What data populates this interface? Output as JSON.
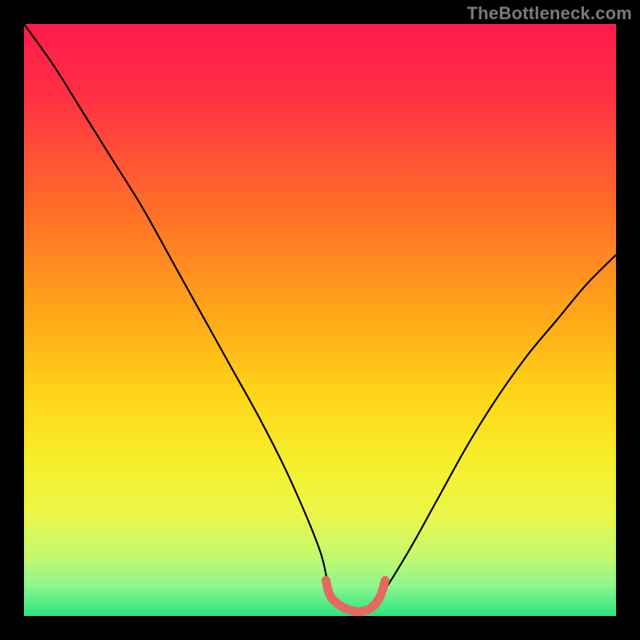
{
  "watermark": "TheBottleneck.com",
  "chart_data": {
    "type": "line",
    "title": "",
    "xlabel": "",
    "ylabel": "",
    "xlim": [
      0,
      100
    ],
    "ylim": [
      0,
      100
    ],
    "description": "Bottleneck curve. Y-axis is bottleneck percentage (100 at top, 0 at bottom). X-axis is component balance ratio (0–100). The curve descends from top-left, reaches a flat minimum near 0% around x≈52–60, then rises again toward the right. A short salmon segment marks the optimal flat region. Background is a vertical rainbow gradient (red→yellow→green) representing severity.",
    "series": [
      {
        "name": "bottleneck-curve",
        "x": [
          0,
          5,
          10,
          15,
          20,
          25,
          30,
          35,
          40,
          45,
          50,
          52,
          55,
          58,
          60,
          65,
          70,
          75,
          80,
          85,
          90,
          95,
          100
        ],
        "y": [
          100,
          93,
          85,
          77,
          69,
          60,
          51,
          42,
          33,
          23,
          11,
          3,
          1,
          1,
          3,
          11,
          20,
          29,
          37,
          44,
          50,
          56,
          61
        ]
      },
      {
        "name": "optimal-marker",
        "x": [
          51,
          52,
          55,
          58,
          60,
          61
        ],
        "y": [
          6,
          3,
          1,
          1,
          3,
          6
        ]
      }
    ],
    "gradient_stops": [
      {
        "offset": 0.0,
        "color": "#ff1a4b"
      },
      {
        "offset": 0.12,
        "color": "#ff3044"
      },
      {
        "offset": 0.3,
        "color": "#ff6a2a"
      },
      {
        "offset": 0.48,
        "color": "#ffa319"
      },
      {
        "offset": 0.62,
        "color": "#ffd318"
      },
      {
        "offset": 0.74,
        "color": "#f6ef2a"
      },
      {
        "offset": 0.83,
        "color": "#eaf74a"
      },
      {
        "offset": 0.9,
        "color": "#c3f86f"
      },
      {
        "offset": 0.95,
        "color": "#8ef58e"
      },
      {
        "offset": 1.0,
        "color": "#27e57e"
      }
    ],
    "colors": {
      "curve": "#000000",
      "marker": "#e46a61",
      "frame": "#000000"
    }
  }
}
